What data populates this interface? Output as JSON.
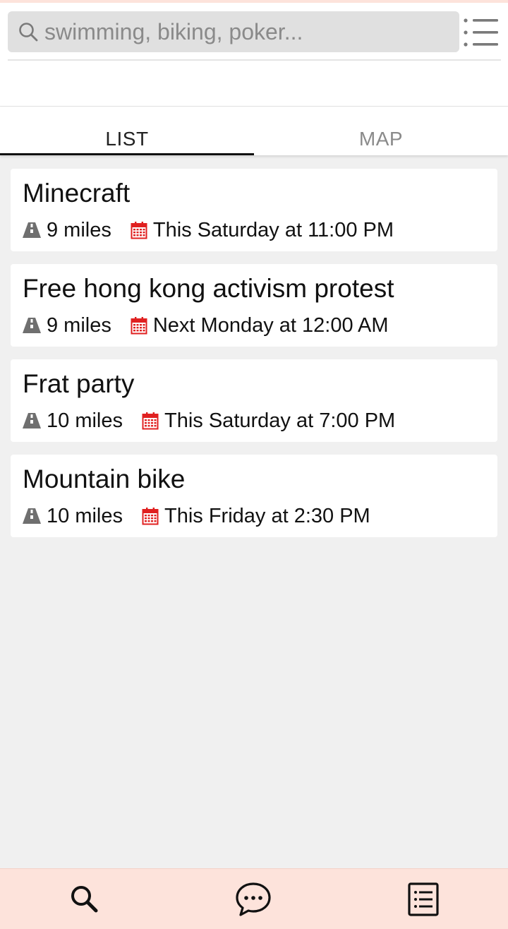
{
  "search": {
    "placeholder": "swimming, biking, poker...",
    "value": ""
  },
  "tabs": [
    {
      "label": "LIST",
      "active": true
    },
    {
      "label": "MAP",
      "active": false
    }
  ],
  "events": [
    {
      "title": "Minecraft",
      "distance": "9 miles",
      "time": "This Saturday at 11:00 PM"
    },
    {
      "title": "Free hong kong activism protest",
      "distance": "9 miles",
      "time": "Next Monday at 12:00 AM"
    },
    {
      "title": "Frat party",
      "distance": "10 miles",
      "time": "This Saturday at 7:00 PM"
    },
    {
      "title": "Mountain bike",
      "distance": "10 miles",
      "time": "This Friday at 2:30 PM"
    }
  ],
  "icons": {
    "search": "search-icon",
    "menu": "list-menu-icon",
    "distance": "road-icon",
    "date": "calendar-icon",
    "nav_search": "search-icon",
    "nav_chat": "chat-bubble-icon",
    "nav_list": "document-list-icon"
  },
  "colors": {
    "accent_red": "#e02020",
    "nav_background": "#fde3db",
    "page_background": "#f0f0f0",
    "search_background": "#e0e0e0",
    "tab_inactive": "#8a8a8a"
  }
}
